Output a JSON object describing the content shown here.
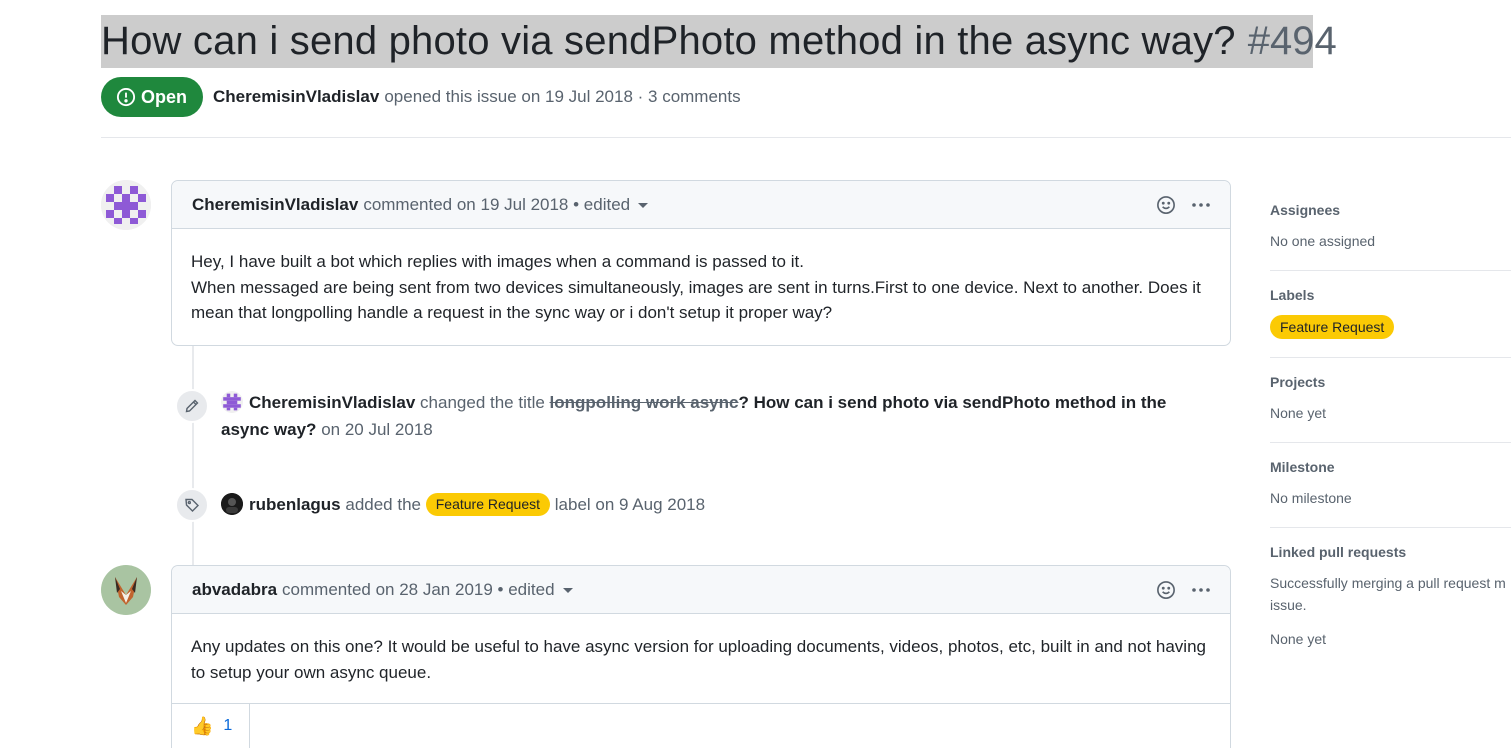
{
  "issue": {
    "title": "How can i send photo via sendPhoto method in the async way?",
    "number": "#494",
    "state": "Open",
    "author": "CheremisinVladislav",
    "meta": "opened this issue on 19 Jul 2018 · 3 comments"
  },
  "comments": [
    {
      "author": "CheremisinVladislav",
      "action": "commented on 19 Jul 2018 • edited",
      "body": [
        "Hey, I have built a bot which replies with images when a command is passed to it.",
        "When messaged are being sent from two devices simultaneously, images are sent in turns.First to one device. Next to another. Does it mean that longpolling handle a request in the sync way or i don't setup it proper way?"
      ]
    },
    {
      "author": "abvadabra",
      "action": "commented on 28 Jan 2019 • edited",
      "body": [
        "Any updates on this one? It would be useful to have async version for uploading documents, videos, photos, etc, built in and not having to setup your own async queue."
      ],
      "reactions": [
        {
          "emoji": "👍",
          "count": "1"
        }
      ]
    }
  ],
  "events": {
    "rename": {
      "actor": "CheremisinVladislav",
      "prefix": "changed the title",
      "old_title": "longpolling work async",
      "new_title": "How can i send photo via sendPhoto method in the async way?",
      "date": "on 20 Jul 2018"
    },
    "label": {
      "actor": "rubenlagus",
      "prefix": "added the",
      "label": "Feature Request",
      "suffix": "label on 9 Aug 2018"
    }
  },
  "sidebar": {
    "assignees": {
      "title": "Assignees",
      "value": "No one assigned"
    },
    "labels": {
      "title": "Labels",
      "value": "Feature Request"
    },
    "projects": {
      "title": "Projects",
      "value": "None yet"
    },
    "milestone": {
      "title": "Milestone",
      "value": "No milestone"
    },
    "linked": {
      "title": "Linked pull requests",
      "value": "Successfully merging a pull request may close this issue.",
      "none": "None yet"
    }
  },
  "colors": {
    "open_green": "#1f883d",
    "label_yellow": "#fbca04",
    "avatar_purple": "#8e5ad6"
  }
}
